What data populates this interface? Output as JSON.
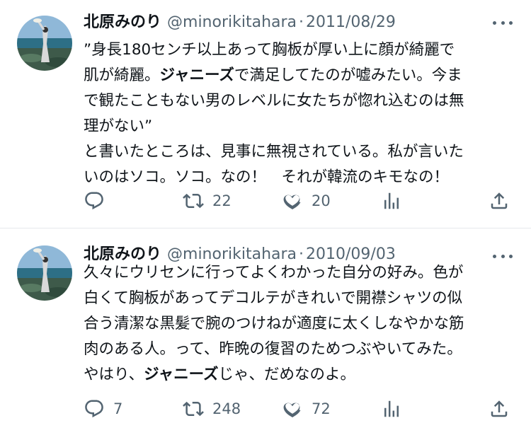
{
  "tweets": [
    {
      "name": "北原みのり",
      "handle": "@minorikitahara",
      "separator": "·",
      "date": "2011/08/29",
      "body_lines": [
        [
          {
            "t": "”身長180センチ以上あって胸板が厚い上に顔が綺麗で"
          }
        ],
        [
          {
            "t": "肌が綺麗。"
          },
          {
            "t": "ジャニーズ",
            "b": true
          },
          {
            "t": "で満足してたのが嘘みたい。今ま"
          }
        ],
        [
          {
            "t": "で観たこともない男のレベルに女たちが惚れ込むのは無"
          }
        ],
        [
          {
            "t": "理がない”"
          }
        ],
        [
          {
            "t": "と書いたところは、見事に無視されている。私が言いた"
          }
        ],
        [
          {
            "t": "いのはソコ。ソコ。なの！　それが韓流のキモなの！"
          }
        ]
      ],
      "replies": "",
      "retweets": "22",
      "likes": "20"
    },
    {
      "name": "北原みのり",
      "handle": "@minorikitahara",
      "separator": "·",
      "date": "2010/09/03",
      "body_lines": [
        [
          {
            "t": "久々にウリセンに行ってよくわかった自分の好み。色が"
          }
        ],
        [
          {
            "t": "白くて胸板があってデコルテがきれいで開襟シャツの似"
          }
        ],
        [
          {
            "t": "合う清潔な黒髪で腕のつけねが適度に太くしなやかな筋"
          }
        ],
        [
          {
            "t": "肉のある人。って、昨晩の復習のためつぶやいてみた。"
          }
        ],
        [
          {
            "t": "やはり、"
          },
          {
            "t": "ジャニーズ",
            "b": true
          },
          {
            "t": "じゃ、だめなのよ。"
          }
        ]
      ],
      "replies": "7",
      "retweets": "248",
      "likes": "72"
    }
  ],
  "icons": [
    "reply-icon",
    "retweet-icon",
    "like-icon",
    "views-icon",
    "share-icon",
    "more-icon"
  ],
  "colors": {
    "text": "#0f1419",
    "muted": "#536471",
    "divider": "#e6e9eb"
  }
}
